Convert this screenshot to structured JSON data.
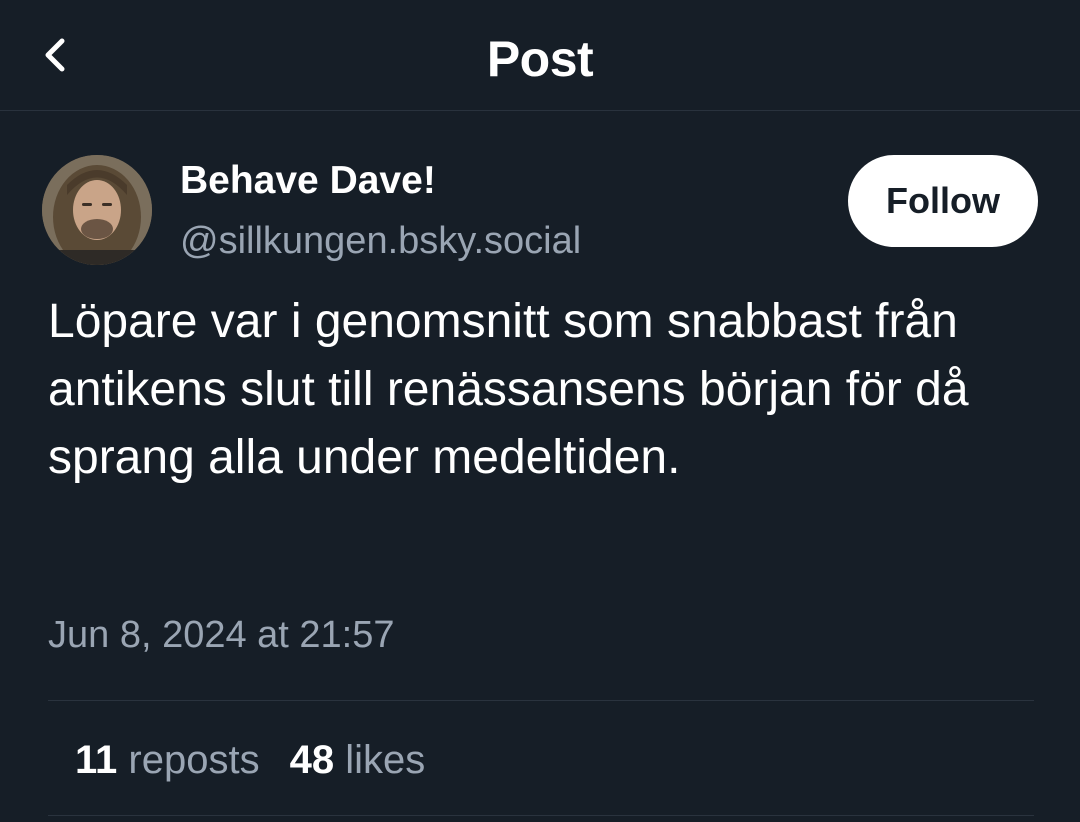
{
  "header": {
    "title": "Post"
  },
  "post": {
    "author_name": "Behave Dave!",
    "author_handle": "@sillkungen.bsky.social",
    "follow_label": "Follow",
    "text": "Löpare var i genomsnitt som snabbast från antikens slut till renässansens början för då sprang alla under medeltiden.",
    "timestamp": "Jun 8, 2024 at 21:57"
  },
  "stats": {
    "reposts_count": "11",
    "reposts_label": "reposts",
    "likes_count": "48",
    "likes_label": "likes"
  },
  "icons": {
    "back": "chevron-left-icon"
  },
  "colors": {
    "background": "#161e27",
    "secondary_text": "#9aa5b3",
    "follow_button_bg": "#ffffff"
  }
}
